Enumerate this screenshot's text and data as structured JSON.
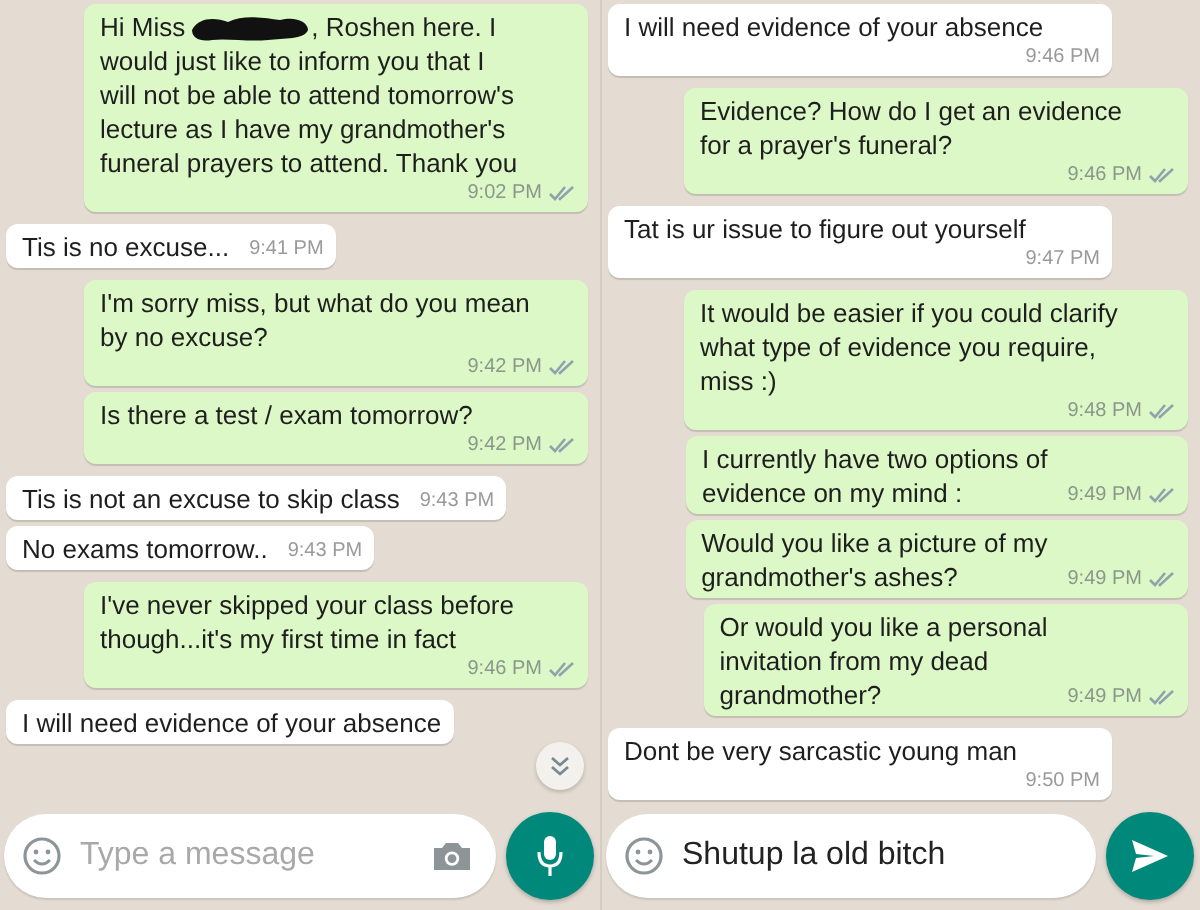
{
  "panes": [
    {
      "messages": [
        {
          "kind": "outgoing",
          "text": "Hi Miss",
          "redacted": true,
          "text_after": ", Roshen here. I",
          "text_more": "would just like to inform you that I\nwill not be able to attend tomorrow's\nlecture as I have my grandmother's\nfuneral prayers to attend. Thank you",
          "time": "9:02 PM",
          "delivered": true
        },
        {
          "kind": "incoming",
          "text": "Tis is no excuse...",
          "time": "9:41 PM"
        },
        {
          "kind": "outgoing",
          "text": "I'm sorry miss, but what do you mean\nby no excuse?",
          "time": "9:42 PM",
          "delivered": true
        },
        {
          "kind": "outgoing",
          "text": "Is there a test / exam tomorrow?",
          "time": "9:42 PM",
          "delivered": true
        },
        {
          "kind": "incoming",
          "text": "Tis is not an excuse to skip class",
          "time": "9:43 PM"
        },
        {
          "kind": "incoming",
          "text": "No exams tomorrow..",
          "time": "9:43 PM"
        },
        {
          "kind": "outgoing",
          "text": "I've never skipped your class before\nthough...it's my first time in fact",
          "time": "9:46 PM",
          "delivered": true
        },
        {
          "kind": "incoming",
          "text": "I will need evidence of your absence"
        }
      ],
      "scroll_down": true,
      "composer": {
        "placeholder": "Type a message",
        "camera": true
      },
      "action_button": {
        "kind": "mic"
      }
    },
    {
      "messages": [
        {
          "kind": "incoming",
          "text": "I will need evidence of your absence",
          "time": "9:46 PM"
        },
        {
          "kind": "outgoing",
          "text": "Evidence? How do I get an evidence\nfor a prayer's funeral?",
          "time": "9:46 PM",
          "delivered": true
        },
        {
          "kind": "incoming",
          "text": "Tat is ur issue to figure out yourself",
          "time": "9:47 PM"
        },
        {
          "kind": "outgoing",
          "text": "It would be easier if you could clarify\nwhat type of evidence you require,\nmiss :)",
          "time": "9:48 PM",
          "delivered": true
        },
        {
          "kind": "outgoing",
          "text": "I currently have two options of\nevidence on my mind :",
          "time": "9:49 PM",
          "delivered": true
        },
        {
          "kind": "outgoing",
          "text": "Would you like a picture of my\ngrandmother's ashes?",
          "time": "9:49 PM",
          "delivered": true
        },
        {
          "kind": "outgoing",
          "text": "Or would you like a personal\ninvitation from my dead\ngrandmother?",
          "time": "9:49 PM",
          "delivered": true
        },
        {
          "kind": "incoming",
          "text": "Dont be very sarcastic young man",
          "time": "9:50 PM"
        }
      ],
      "composer": {
        "value": "Shutup la old bitch"
      },
      "action_button": {
        "kind": "send"
      }
    }
  ]
}
